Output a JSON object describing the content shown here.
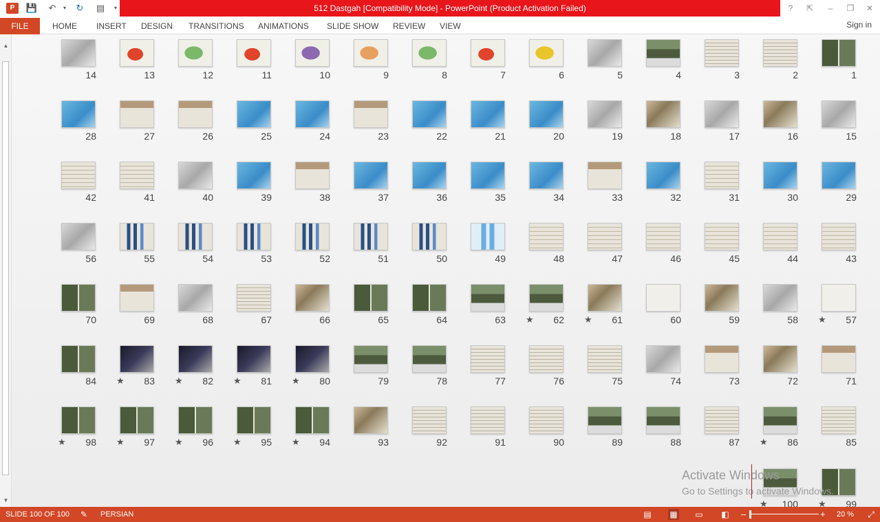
{
  "app": {
    "title": "512 Dastgah [Compatibility Mode] -  PowerPoint (Product Activation Failed)",
    "logo": "P",
    "accent": "#d24726",
    "title_bg": "#e8151b"
  },
  "qat": {
    "save_icon": "save-icon",
    "undo_icon": "undo-icon",
    "redo_icon": "repeat-icon",
    "present_icon": "present-icon"
  },
  "window": {
    "help": "?",
    "restore_ribbon": "⇱",
    "minimize": "–",
    "maximize": "❐",
    "close": "✕"
  },
  "ribbon": {
    "file": "FILE",
    "tabs": [
      "HOME",
      "INSERT",
      "DESIGN",
      "TRANSITIONS",
      "ANIMATIONS",
      "SLIDE SHOW",
      "REVIEW",
      "VIEW"
    ],
    "signin": "Sign in"
  },
  "slides": [
    {
      "n": "14",
      "t": "t-grey"
    },
    {
      "n": "13",
      "t": "t-map"
    },
    {
      "n": "12",
      "t": "t-mapg"
    },
    {
      "n": "11",
      "t": "t-map"
    },
    {
      "n": "10",
      "t": "t-mapp"
    },
    {
      "n": "9",
      "t": "t-mapo"
    },
    {
      "n": "8",
      "t": "t-mapg"
    },
    {
      "n": "7",
      "t": "t-map"
    },
    {
      "n": "6",
      "t": "t-mapy"
    },
    {
      "n": "5",
      "t": "t-grey"
    },
    {
      "n": "4",
      "t": "t-photo"
    },
    {
      "n": "3",
      "t": "t-text"
    },
    {
      "n": "2",
      "t": "t-text"
    },
    {
      "n": "1",
      "t": "t-photo2"
    },
    {
      "n": "28",
      "t": "t-blue"
    },
    {
      "n": "27",
      "t": "t-tableh"
    },
    {
      "n": "26",
      "t": "t-tableh"
    },
    {
      "n": "25",
      "t": "t-blue"
    },
    {
      "n": "24",
      "t": "t-blue"
    },
    {
      "n": "23",
      "t": "t-tableh"
    },
    {
      "n": "22",
      "t": "t-blue"
    },
    {
      "n": "21",
      "t": "t-blue"
    },
    {
      "n": "20",
      "t": "t-blue"
    },
    {
      "n": "19",
      "t": "t-grey"
    },
    {
      "n": "18",
      "t": "t-plan"
    },
    {
      "n": "17",
      "t": "t-grey"
    },
    {
      "n": "16",
      "t": "t-plan"
    },
    {
      "n": "15",
      "t": "t-grey"
    },
    {
      "n": "42",
      "t": "t-table"
    },
    {
      "n": "41",
      "t": "t-table"
    },
    {
      "n": "40",
      "t": "t-grey"
    },
    {
      "n": "39",
      "t": "t-blue"
    },
    {
      "n": "38",
      "t": "t-tableh"
    },
    {
      "n": "37",
      "t": "t-blue"
    },
    {
      "n": "36",
      "t": "t-blue"
    },
    {
      "n": "35",
      "t": "t-blue"
    },
    {
      "n": "34",
      "t": "t-blue"
    },
    {
      "n": "33",
      "t": "t-tableh"
    },
    {
      "n": "32",
      "t": "t-blue"
    },
    {
      "n": "31",
      "t": "t-table"
    },
    {
      "n": "30",
      "t": "t-blue"
    },
    {
      "n": "29",
      "t": "t-blue"
    },
    {
      "n": "56",
      "t": "t-grey"
    },
    {
      "n": "55",
      "t": "t-chart"
    },
    {
      "n": "54",
      "t": "t-chart"
    },
    {
      "n": "53",
      "t": "t-chart"
    },
    {
      "n": "52",
      "t": "t-chart"
    },
    {
      "n": "51",
      "t": "t-chart"
    },
    {
      "n": "50",
      "t": "t-chart"
    },
    {
      "n": "49",
      "t": "t-chartl"
    },
    {
      "n": "48",
      "t": "t-table"
    },
    {
      "n": "47",
      "t": "t-table"
    },
    {
      "n": "46",
      "t": "t-table"
    },
    {
      "n": "45",
      "t": "t-table"
    },
    {
      "n": "44",
      "t": "t-table"
    },
    {
      "n": "43",
      "t": "t-table"
    },
    {
      "n": "70",
      "t": "t-photo2"
    },
    {
      "n": "69",
      "t": "t-tableh"
    },
    {
      "n": "68",
      "t": "t-grey"
    },
    {
      "n": "67",
      "t": "t-text"
    },
    {
      "n": "66",
      "t": "t-plan"
    },
    {
      "n": "65",
      "t": "t-photo2"
    },
    {
      "n": "64",
      "t": "t-photo2"
    },
    {
      "n": "63",
      "t": "t-photo"
    },
    {
      "n": "62",
      "t": "t-photo",
      "star": true
    },
    {
      "n": "61",
      "t": "t-plan",
      "star": true
    },
    {
      "n": "60",
      "t": "t-white"
    },
    {
      "n": "59",
      "t": "t-plan"
    },
    {
      "n": "58",
      "t": "t-grey"
    },
    {
      "n": "57",
      "t": "t-white",
      "star": true
    },
    {
      "n": "84",
      "t": "t-photo2"
    },
    {
      "n": "83",
      "t": "t-dark",
      "star": true
    },
    {
      "n": "82",
      "t": "t-dark",
      "star": true
    },
    {
      "n": "81",
      "t": "t-dark",
      "star": true
    },
    {
      "n": "80",
      "t": "t-dark",
      "star": true
    },
    {
      "n": "79",
      "t": "t-photo"
    },
    {
      "n": "78",
      "t": "t-photo"
    },
    {
      "n": "77",
      "t": "t-text"
    },
    {
      "n": "76",
      "t": "t-text"
    },
    {
      "n": "75",
      "t": "t-text"
    },
    {
      "n": "74",
      "t": "t-grey"
    },
    {
      "n": "73",
      "t": "t-tableh"
    },
    {
      "n": "72",
      "t": "t-plan"
    },
    {
      "n": "71",
      "t": "t-tableh"
    },
    {
      "n": "98",
      "t": "t-photo2",
      "star": true
    },
    {
      "n": "97",
      "t": "t-photo2",
      "star": true
    },
    {
      "n": "96",
      "t": "t-photo2",
      "star": true
    },
    {
      "n": "95",
      "t": "t-photo2",
      "star": true
    },
    {
      "n": "94",
      "t": "t-photo2",
      "star": true
    },
    {
      "n": "93",
      "t": "t-plan"
    },
    {
      "n": "92",
      "t": "t-text"
    },
    {
      "n": "91",
      "t": "t-text"
    },
    {
      "n": "90",
      "t": "t-text"
    },
    {
      "n": "89",
      "t": "t-photo"
    },
    {
      "n": "88",
      "t": "t-photo"
    },
    {
      "n": "87",
      "t": "t-text"
    },
    {
      "n": "86",
      "t": "t-photo",
      "star": true
    },
    {
      "n": "85",
      "t": "t-text"
    },
    {
      "n": "100",
      "t": "t-photo",
      "star": true
    },
    {
      "n": "99",
      "t": "t-photo2",
      "star": true
    }
  ],
  "watermark": {
    "line1": "Activate Windows",
    "line2": "Go to Settings to activate Windows."
  },
  "status": {
    "slide": "SLIDE 100 OF 100",
    "language": "PERSIAN",
    "zoom": "20 %",
    "zoom_out": "–",
    "zoom_in": "+",
    "star": "★"
  }
}
